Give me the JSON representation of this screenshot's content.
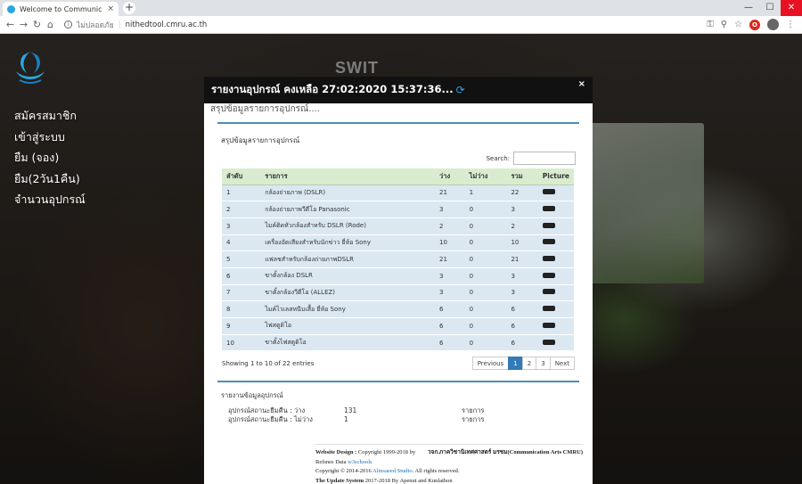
{
  "browser": {
    "tab_title": "Welcome to Communication Arts",
    "tab_close": "×",
    "new_tab": "+",
    "security_text": "ไม่ปลอดภัย",
    "url": "nithedtool.cmru.ac.th",
    "window_controls": {
      "minimize": "—",
      "maximize": "☐",
      "close": "✕"
    },
    "nav": {
      "back": "←",
      "forward": "→",
      "reload": "↻",
      "home": "⌂"
    },
    "tools": {
      "key": "⚿",
      "zoom": "⚲",
      "star": "☆",
      "ext": "O",
      "menu": "⋮"
    }
  },
  "background": {
    "camera_label": "SWIT"
  },
  "sidebar": {
    "items": [
      {
        "label": "สมัครสมาชิก"
      },
      {
        "label": "เข้าสู่ระบบ"
      },
      {
        "label": "ยืม (จอง)"
      },
      {
        "label": "ยืม(2วัน1คืน)"
      },
      {
        "label": "จำนวนอุปกรณ์"
      }
    ]
  },
  "modal": {
    "title": "รายงานอุปกรณ์ คงเหลือ 27:02:2020 15:37:36...",
    "refresh_glyph": "⟳",
    "close": "×",
    "subtitle": "สรุปข้อมูลรายการอุปกรณ์....",
    "panel_title": "สรุปข้อมูลรายการอุปกรณ์",
    "search_label": "Search:",
    "table": {
      "headers": [
        "ลำดับ",
        "รายการ",
        "ว่าง",
        "ไม่ว่าง",
        "รวม",
        "Picture"
      ],
      "rows": [
        {
          "no": "1",
          "item": "กล้องถ่ายภาพ (DSLR)",
          "free": "21",
          "busy": "1",
          "total": "22"
        },
        {
          "no": "2",
          "item": "กล้องถ่ายภาพวีดีโอ Panasonic",
          "free": "3",
          "busy": "0",
          "total": "3"
        },
        {
          "no": "3",
          "item": "ไมค์ติดหัวกล้องสำหรับ DSLR (Rode)",
          "free": "2",
          "busy": "0",
          "total": "2"
        },
        {
          "no": "4",
          "item": "เครื่องอัดเสียงสำหรับนักข่าว ยี่ห้อ Sony",
          "free": "10",
          "busy": "0",
          "total": "10"
        },
        {
          "no": "5",
          "item": "แฟลชสำหรับกล้องถ่ายภาพDSLR",
          "free": "21",
          "busy": "0",
          "total": "21"
        },
        {
          "no": "6",
          "item": "ขาตั้งกล้อง DSLR",
          "free": "3",
          "busy": "0",
          "total": "3"
        },
        {
          "no": "7",
          "item": "ขาตั้งกล้องวีดีโอ (ALLEZ)",
          "free": "3",
          "busy": "0",
          "total": "3"
        },
        {
          "no": "8",
          "item": "ไมค์ไวเลสหนีบเสื้อ ยี่ห้อ Sony",
          "free": "6",
          "busy": "0",
          "total": "6"
        },
        {
          "no": "9",
          "item": "ไฟสตูดิโอ",
          "free": "6",
          "busy": "0",
          "total": "6"
        },
        {
          "no": "10",
          "item": "ขาตั้งไฟสตูดิโอ",
          "free": "6",
          "busy": "0",
          "total": "6"
        }
      ]
    },
    "entries_info": "Showing 1 to 10 of 22 entries",
    "pager": {
      "previous": "Previous",
      "p1": "1",
      "p2": "2",
      "p3": "3",
      "next": "Next"
    },
    "summary": {
      "title": "รายงานข้อมูลอุปกรณ์",
      "row1": {
        "label": "อุปกรณ์สถานะยืมคืน : ว่าง",
        "value": "131",
        "unit": "รายการ"
      },
      "row2": {
        "label": "อุปกรณ์สถานะยืมคืน : ไม่ว่าง",
        "value": "1",
        "unit": "รายการ"
      }
    },
    "footer": {
      "l1_bold": "Website Design :",
      "l1_text": " Copyright 1999-2018 by",
      "l1_right": "วจก.ภาควิชานิเทศศาสตร์ มรชม(Communication Arts CMRU)",
      "l2_text": "Refsnes Data ",
      "l2_link": "w3schools",
      "l3_text": "Copyright © 2014-2016 ",
      "l3_link": "Almsaeed Studio",
      "l3_tail": ". All rights reserved.",
      "l4_bold": "The Update System",
      "l4_text": " 2017-2018 By Apenut and Kunlathon"
    }
  }
}
